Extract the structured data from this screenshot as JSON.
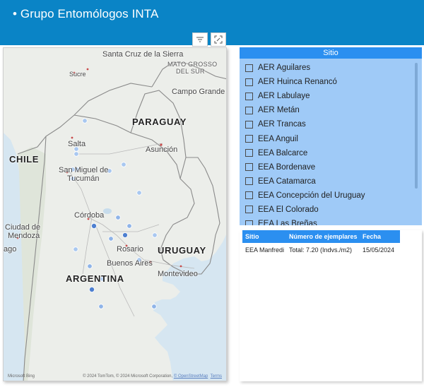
{
  "header": {
    "title": "• Grupo Entomólogos INTA"
  },
  "toolbar": {
    "filter_icon": "filter-icon",
    "focus_icon": "focus-mode-icon"
  },
  "map": {
    "labels": {
      "santa_cruz": "Santa Cruz de la Sierra",
      "mato_grosso_1": "MATO GROSSO",
      "mato_grosso_2": "DEL SUR",
      "sucre": "Sucre",
      "campo_grande": "Campo Grande",
      "paraguay": "PARAGUAY",
      "salta": "Salta",
      "asuncion": "Asunción",
      "chile": "CHILE",
      "san_miguel_1": "San Miguel de",
      "san_miguel_2": "Tucumán",
      "cordoba": "Córdoba",
      "ciudad_mendoza_1": "Ciudad de",
      "ciudad_mendoza_2": "Mendoza",
      "rosario": "Rosario",
      "uruguay": "URUGUAY",
      "santiago_frag": "ago",
      "buenos_aires": "Buenos Aires",
      "montevideo": "Montevideo",
      "argentina": "ARGENTINA"
    },
    "bing": "Microsoft Bing",
    "credits_prefix": "© 2024 TomTom, © 2024 Microsoft Corporation, ",
    "credits_osm": "© OpenStreetMap",
    "credits_terms": "Terms",
    "colors": {
      "point_light": "#a9c8f0",
      "point_dark": "#4d7fd0"
    }
  },
  "slicer": {
    "title": "Sitio",
    "items": [
      "AER Aguilares",
      "AER Huinca Renancó",
      "AER Labulaye",
      "AER Metán",
      "AER Trancas",
      "EEA Anguil",
      "EEA Balcarce",
      "EEA Bordenave",
      "EEA Catamarca",
      "EEA Concepción del Uruguay",
      "EEA El Colorado",
      "EEA Las Breñas"
    ]
  },
  "table": {
    "headers": [
      "Sitio",
      "Número de ejemplares",
      "Fecha"
    ],
    "rows": [
      [
        "EEA Manfredi",
        "Total: 7.20 (Indvs./m2)",
        "15/05/2024"
      ]
    ]
  }
}
